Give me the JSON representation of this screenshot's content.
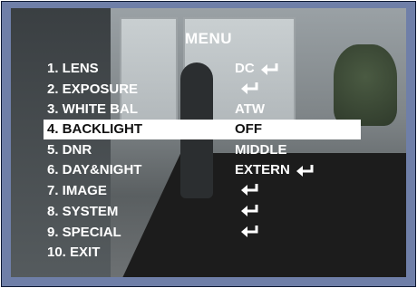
{
  "menu": {
    "title": "MENU",
    "items": [
      {
        "label": "1. LENS",
        "value": "DC",
        "enter_icon": true
      },
      {
        "label": "2. EXPOSURE",
        "value": "",
        "enter_icon": true
      },
      {
        "label": "3. WHITE BAL",
        "value": "ATW",
        "enter_icon": false
      },
      {
        "label": "4. BACKLIGHT",
        "value": "OFF",
        "enter_icon": false,
        "selected": true
      },
      {
        "label": "5. DNR",
        "value": "MIDDLE",
        "enter_icon": false
      },
      {
        "label": "6. DAY&NIGHT",
        "value": "EXTERN",
        "enter_icon": true
      },
      {
        "label": "7. IMAGE",
        "value": "",
        "enter_icon": true
      },
      {
        "label": "8. SYSTEM",
        "value": "",
        "enter_icon": true
      },
      {
        "label": "9. SPECIAL",
        "value": "",
        "enter_icon": true
      },
      {
        "label": "10. EXIT",
        "value": "",
        "enter_icon": false
      }
    ]
  },
  "colors": {
    "frame": "#6f7fa8",
    "text": "#ffffff",
    "highlight_bg": "#ffffff",
    "highlight_text": "#111111"
  }
}
